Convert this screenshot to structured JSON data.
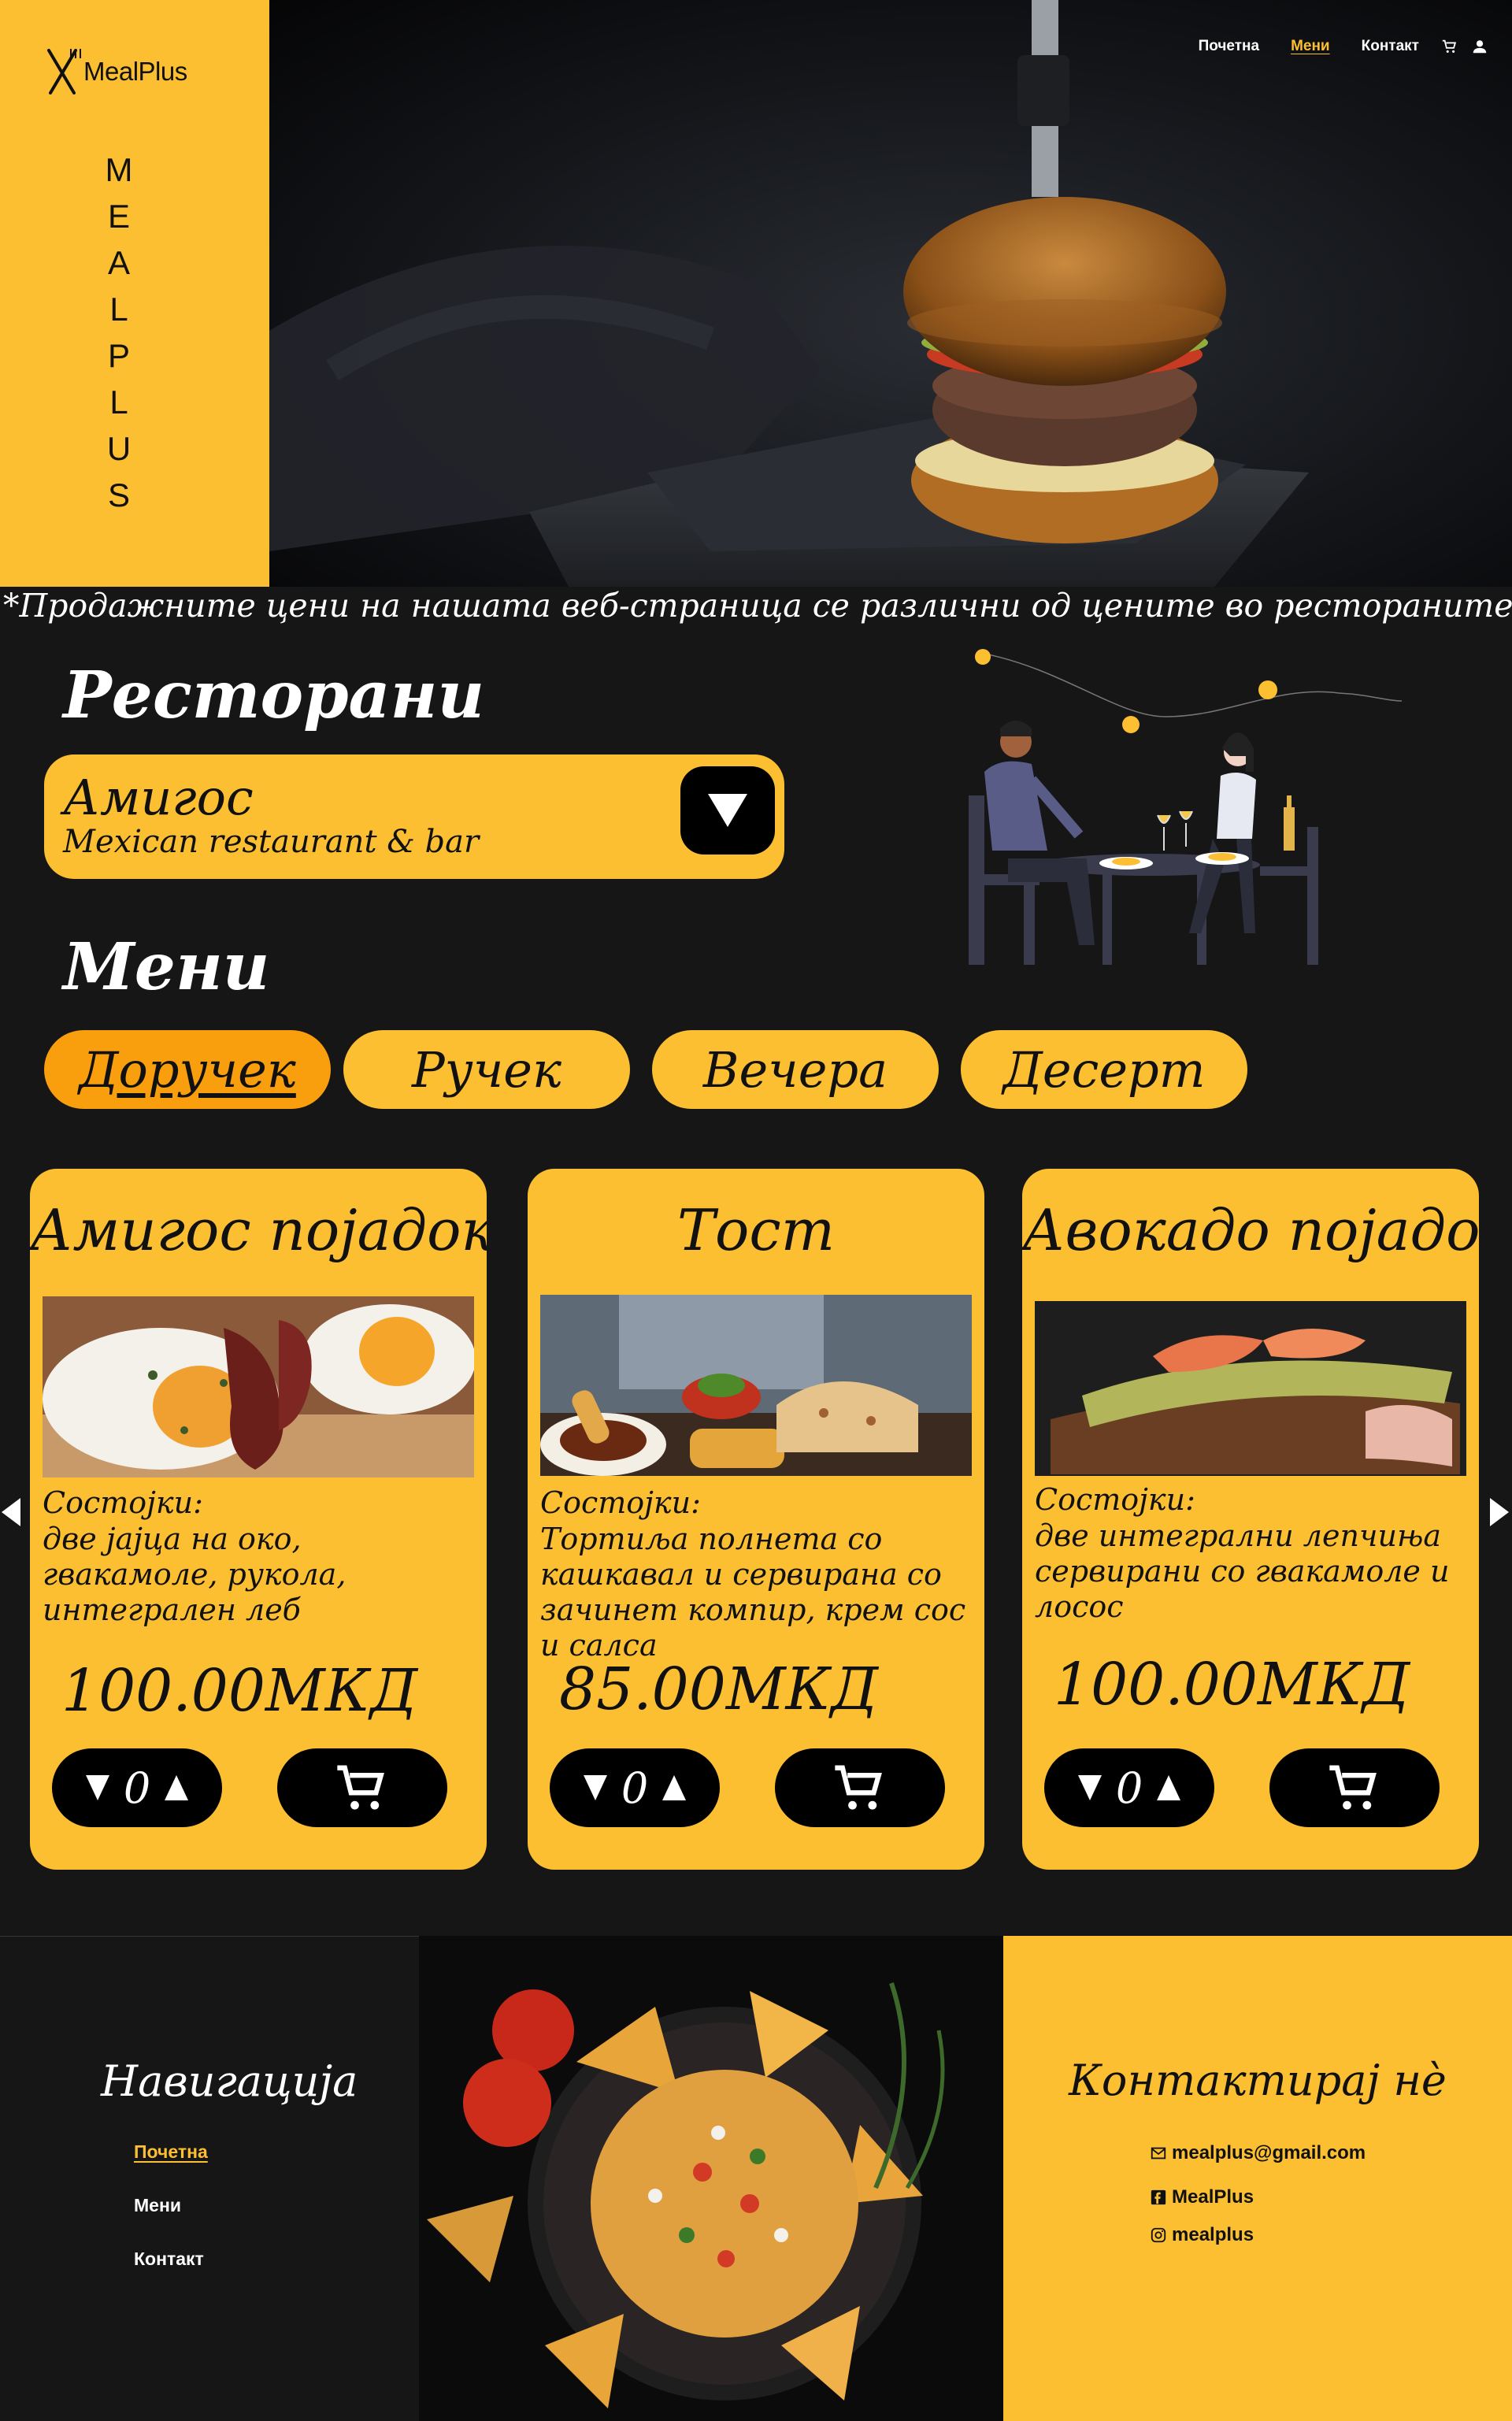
{
  "brand": {
    "logo_text": "MealPlus",
    "vertical_letters": [
      "M",
      "E",
      "A",
      "L",
      "P",
      "L",
      "U",
      "S"
    ],
    "color_accent": "#fbbf31",
    "color_active_tab": "#f99e0c"
  },
  "nav": {
    "items": [
      {
        "label": "Почетна",
        "active": false
      },
      {
        "label": "Мени",
        "active": true
      },
      {
        "label": "Контакт",
        "active": false
      }
    ],
    "icons": [
      "cart-icon",
      "user-icon"
    ]
  },
  "disclaimer": "*Продажните цени на нашата веб-страница се различни од цените во ресторанитe",
  "restaurants": {
    "title": "Ресторани",
    "selected_name": "Амигос",
    "selected_subtitle": "Mexican restaurant & bar"
  },
  "menu": {
    "title": "Мени",
    "tabs": [
      {
        "label": "Доручек",
        "active": true
      },
      {
        "label": "Ручек",
        "active": false
      },
      {
        "label": "Вечера",
        "active": false
      },
      {
        "label": "Десерт",
        "active": false
      }
    ],
    "ingredients_label": "Состојки:",
    "items": [
      {
        "title": "Амигос појадок",
        "ingredients": "две јајца на око, гвакамоле, рукола, интегрален леб",
        "price": "100.00МКД",
        "quantity": "0"
      },
      {
        "title": "Тост",
        "ingredients": "Тортиља полнета со кашкавал и сервирана со зачинет компир, крем сос и салса",
        "price": "85.00МКД",
        "quantity": "0"
      },
      {
        "title": "Авокадо појадок",
        "ingredients": "две интегрални лепчиња сервирани со гвакамоле и лосос",
        "price": "100.00МКД",
        "quantity": "0"
      }
    ]
  },
  "footer": {
    "nav_title": "Навигација",
    "nav_links": [
      {
        "label": "Почетна",
        "active": true
      },
      {
        "label": "Мени",
        "active": false
      },
      {
        "label": "Контакт",
        "active": false
      }
    ],
    "contact_title": "Контактирај нè",
    "contacts": [
      {
        "icon": "mail-icon",
        "text": "mealplus@gmail.com"
      },
      {
        "icon": "facebook-icon",
        "text": "MealPlus"
      },
      {
        "icon": "instagram-icon",
        "text": "mealplus"
      }
    ]
  }
}
